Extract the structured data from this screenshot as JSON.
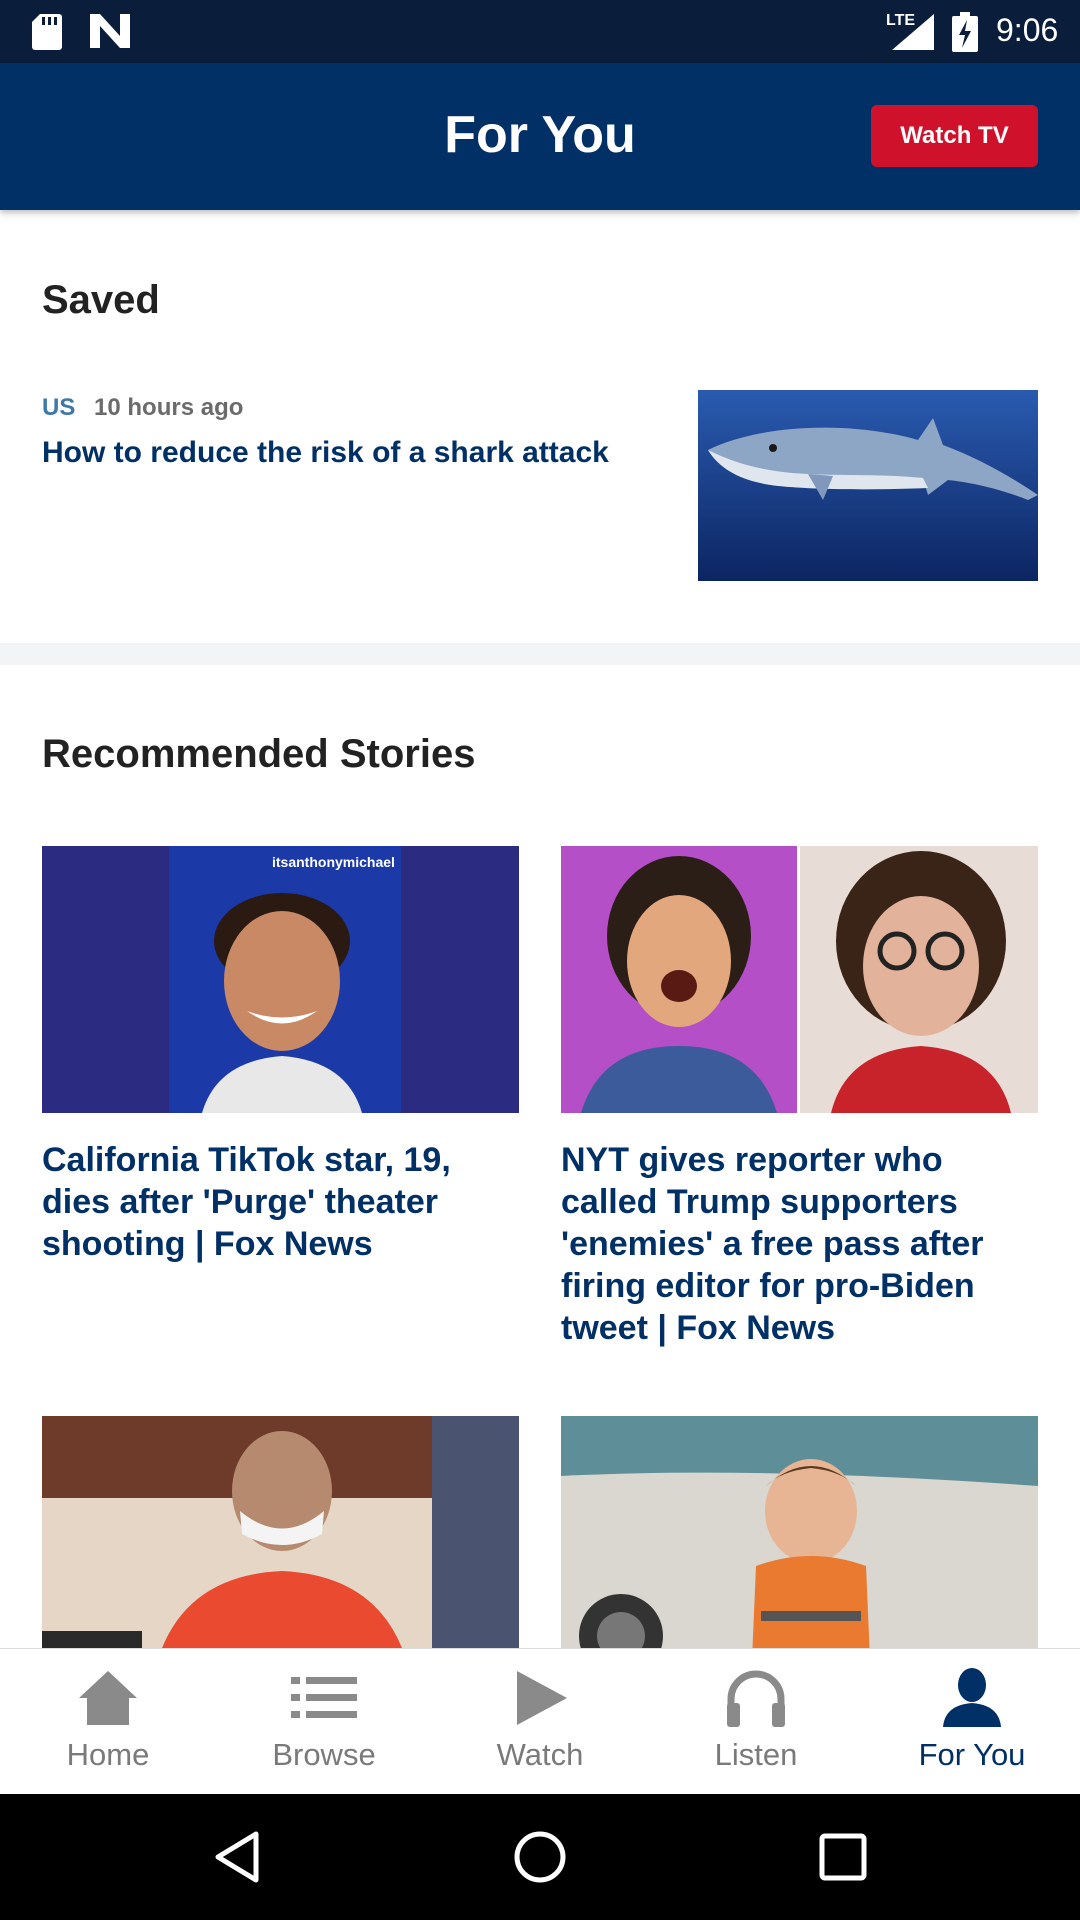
{
  "status_bar": {
    "network": "LTE",
    "time": "9:06",
    "icons": [
      "sd-card-icon",
      "n-app-icon",
      "signal-icon",
      "battery-charging-icon"
    ]
  },
  "header": {
    "title": "For You",
    "watch_tv_label": "Watch TV"
  },
  "saved": {
    "section_title": "Saved",
    "items": [
      {
        "category": "US",
        "time_ago": "10 hours ago",
        "headline": "How to reduce the risk of a shark attack",
        "image": "shark-photo"
      }
    ]
  },
  "recommended": {
    "section_title": "Recommended Stories",
    "stories": [
      {
        "headline": "California TikTok star, 19, dies after 'Purge' theater shooting | Fox News",
        "image": "young-man-portrait",
        "image_caption": "itsanthonymichael"
      },
      {
        "headline": "NYT gives reporter who called Trump supporters 'enemies' a free pass after firing editor for pro-Biden tweet | Fox News",
        "image": "two-women-portraits"
      },
      {
        "headline": "",
        "image": "courtroom-defendant"
      },
      {
        "headline": "",
        "image": "child-on-boat"
      }
    ]
  },
  "bottom_nav": {
    "items": [
      {
        "label": "Home",
        "icon": "home-icon",
        "active": false
      },
      {
        "label": "Browse",
        "icon": "list-icon",
        "active": false
      },
      {
        "label": "Watch",
        "icon": "play-icon",
        "active": false
      },
      {
        "label": "Listen",
        "icon": "headphones-icon",
        "active": false
      },
      {
        "label": "For You",
        "icon": "person-icon",
        "active": true
      }
    ]
  },
  "colors": {
    "header_bg": "#003066",
    "status_bg": "#0a1e3c",
    "accent_red": "#d0112b",
    "headline_blue": "#003066",
    "category_blue": "#3d78a8"
  }
}
